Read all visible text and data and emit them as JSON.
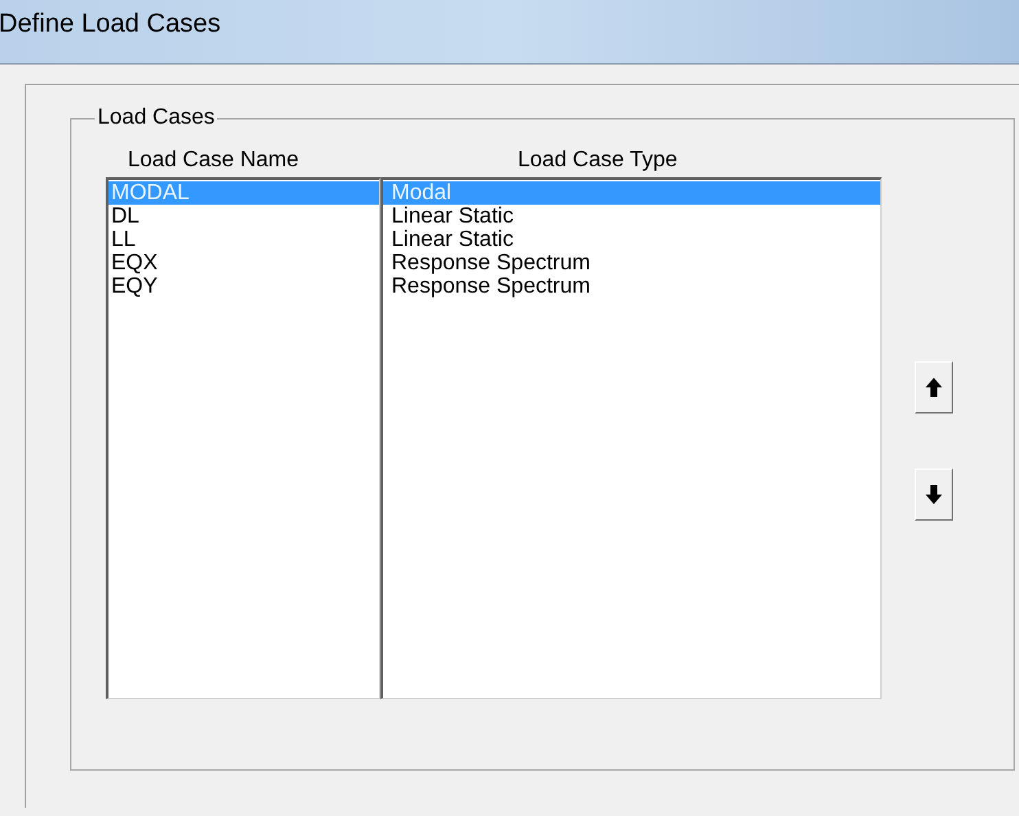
{
  "window": {
    "title": "Define Load Cases"
  },
  "group": {
    "label": "Load Cases"
  },
  "columns": [
    "Load Case Name",
    "Load Case Type"
  ],
  "rows": [
    {
      "name": "MODAL",
      "type": "Modal",
      "selected": true
    },
    {
      "name": "DL",
      "type": "Linear Static",
      "selected": false
    },
    {
      "name": "LL",
      "type": "Linear Static",
      "selected": false
    },
    {
      "name": "EQX",
      "type": "Response Spectrum",
      "selected": false
    },
    {
      "name": "EQY",
      "type": "Response Spectrum",
      "selected": false
    }
  ]
}
